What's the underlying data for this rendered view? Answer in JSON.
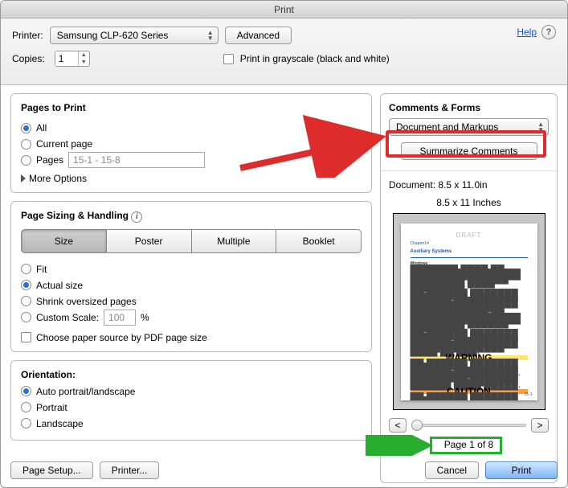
{
  "title": "Print",
  "help_link": "Help",
  "top": {
    "printer_label": "Printer:",
    "printer_value": "Samsung CLP-620 Series",
    "advanced": "Advanced",
    "copies_label": "Copies:",
    "copies_value": "1",
    "grayscale_label": "Print in grayscale (black and white)"
  },
  "pages_panel": {
    "title": "Pages to Print",
    "opt_all": "All",
    "opt_current": "Current page",
    "opt_pages": "Pages",
    "pages_value": "15-1 - 15-8",
    "more_options": "More Options"
  },
  "sizing_panel": {
    "title": "Page Sizing & Handling",
    "seg": {
      "size": "Size",
      "poster": "Poster",
      "multiple": "Multiple",
      "booklet": "Booklet"
    },
    "opt_fit": "Fit",
    "opt_actual": "Actual size",
    "opt_shrink": "Shrink oversized pages",
    "opt_custom": "Custom Scale:",
    "custom_value": "100",
    "custom_unit": "%",
    "choose_paper": "Choose paper source by PDF page size"
  },
  "orientation_panel": {
    "title": "Orientation:",
    "opt_auto": "Auto portrait/landscape",
    "opt_portrait": "Portrait",
    "opt_landscape": "Landscape"
  },
  "comments_panel": {
    "title": "Comments & Forms",
    "select_value": "Document and Markups",
    "summarize": "Summarize Comments"
  },
  "preview": {
    "doc_label": "Document: 8.5 x 11.0in",
    "size_label": "8.5 x 11 Inches",
    "watermark": "DRAFT",
    "chapter": "Chapter14",
    "heading": "Auxiliary Systems",
    "sub": "Windows",
    "warning": "WARNING",
    "caution": "CAUTION",
    "page_of": "Page 1 of 8",
    "prev": "<",
    "next": ">"
  },
  "bottom": {
    "page_setup": "Page Setup...",
    "printer": "Printer...",
    "cancel": "Cancel",
    "print": "Print"
  }
}
